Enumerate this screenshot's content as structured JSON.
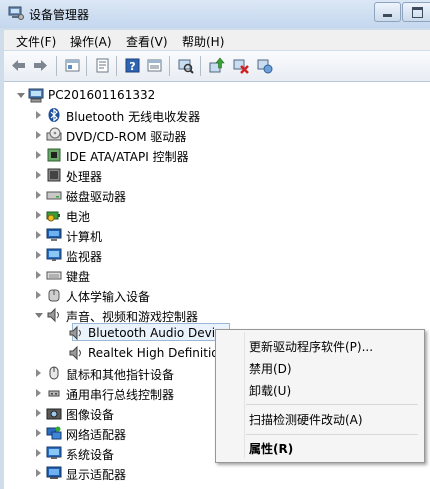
{
  "window": {
    "title": "设备管理器"
  },
  "menu": [
    "文件(F)",
    "操作(A)",
    "查看(V)",
    "帮助(H)"
  ],
  "toolbar": [
    "back-icon",
    "forward-icon",
    "up-icon",
    "properties-icon",
    "help-icon",
    "view-icon",
    "scan-icon",
    "update-driver-icon",
    "uninstall-icon",
    "enable-icon"
  ],
  "tree": {
    "root": "PC201601161332",
    "items": [
      {
        "label": "Bluetooth 无线电收发器",
        "icon": "bluetooth-icon"
      },
      {
        "label": "DVD/CD-ROM 驱动器",
        "icon": "dvd-drive-icon"
      },
      {
        "label": "IDE ATA/ATAPI 控制器",
        "icon": "ide-controller-icon"
      },
      {
        "label": "处理器",
        "icon": "processor-icon"
      },
      {
        "label": "磁盘驱动器",
        "icon": "disk-drive-icon"
      },
      {
        "label": "电池",
        "icon": "battery-icon"
      },
      {
        "label": "计算机",
        "icon": "computer-icon"
      },
      {
        "label": "监视器",
        "icon": "monitor-icon"
      },
      {
        "label": "键盘",
        "icon": "keyboard-icon"
      },
      {
        "label": "人体学输入设备",
        "icon": "hid-icon"
      },
      {
        "label": "声音、视频和游戏控制器",
        "icon": "sound-icon"
      },
      {
        "label": "Bluetooth Audio Devic",
        "icon": "speaker-icon"
      },
      {
        "label": "Realtek High Definitio",
        "icon": "speaker-icon"
      },
      {
        "label": "鼠标和其他指针设备",
        "icon": "mouse-icon"
      },
      {
        "label": "通用串行总线控制器",
        "icon": "usb-icon"
      },
      {
        "label": "图像设备",
        "icon": "imaging-icon"
      },
      {
        "label": "网络适配器",
        "icon": "network-icon"
      },
      {
        "label": "系统设备",
        "icon": "system-icon"
      },
      {
        "label": "显示适配器",
        "icon": "display-icon"
      }
    ]
  },
  "context_menu": {
    "update": "更新驱动程序软件(P)...",
    "disable": "禁用(D)",
    "uninstall": "卸载(U)",
    "scan": "扫描检测硬件改动(A)",
    "properties": "属性(R)"
  }
}
